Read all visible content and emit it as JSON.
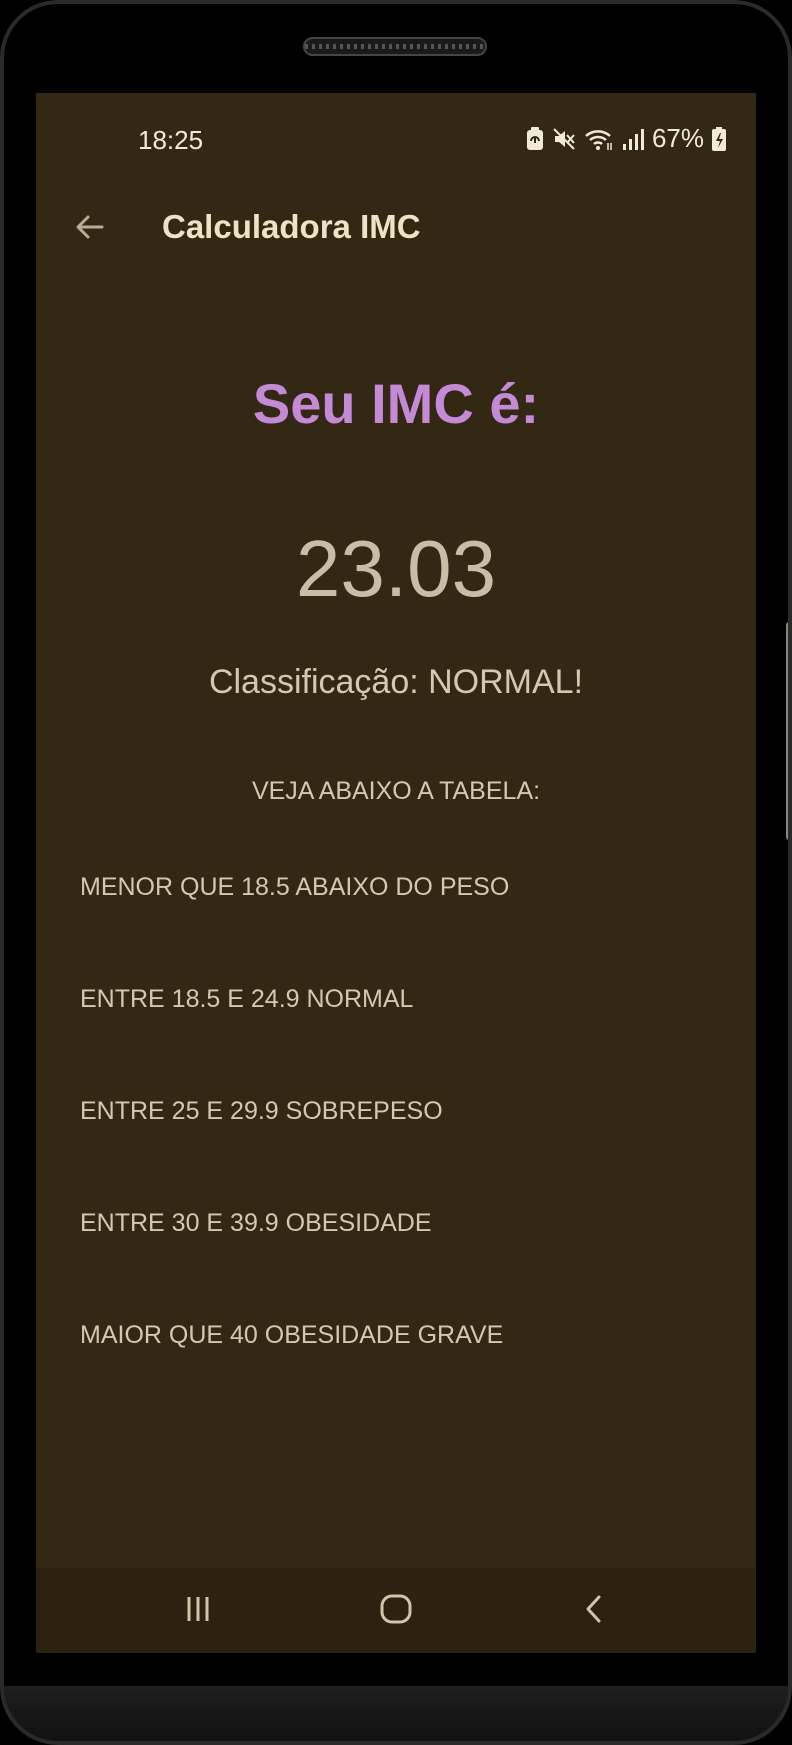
{
  "status_bar": {
    "time": "18:25",
    "battery_percent": "67%",
    "icons": [
      "battery-saver-icon",
      "mute-icon",
      "wifi-icon",
      "signal-icon",
      "battery-icon"
    ]
  },
  "app_bar": {
    "title": "Calculadora IMC",
    "back_icon": "arrow-left-icon"
  },
  "result": {
    "headline": "Seu IMC é:",
    "value": "23.03",
    "classification": "Classificação: NORMAL!"
  },
  "table": {
    "heading": "VEJA ABAIXO A TABELA:",
    "rows": [
      "MENOR QUE 18.5 ABAIXO DO PESO",
      "ENTRE 18.5 E 24.9 NORMAL",
      "ENTRE 25 E 29.9 SOBREPESO",
      "ENTRE 30 E 39.9 OBESIDADE",
      "MAIOR QUE 40 OBESIDADE GRAVE"
    ]
  },
  "nav_bar": {
    "icons": [
      "recent-apps-icon",
      "home-icon",
      "back-icon"
    ]
  },
  "colors": {
    "background": "#332814",
    "headline": "#c48ad6",
    "value": "#c7bea6",
    "text": "#d4c8ad"
  }
}
